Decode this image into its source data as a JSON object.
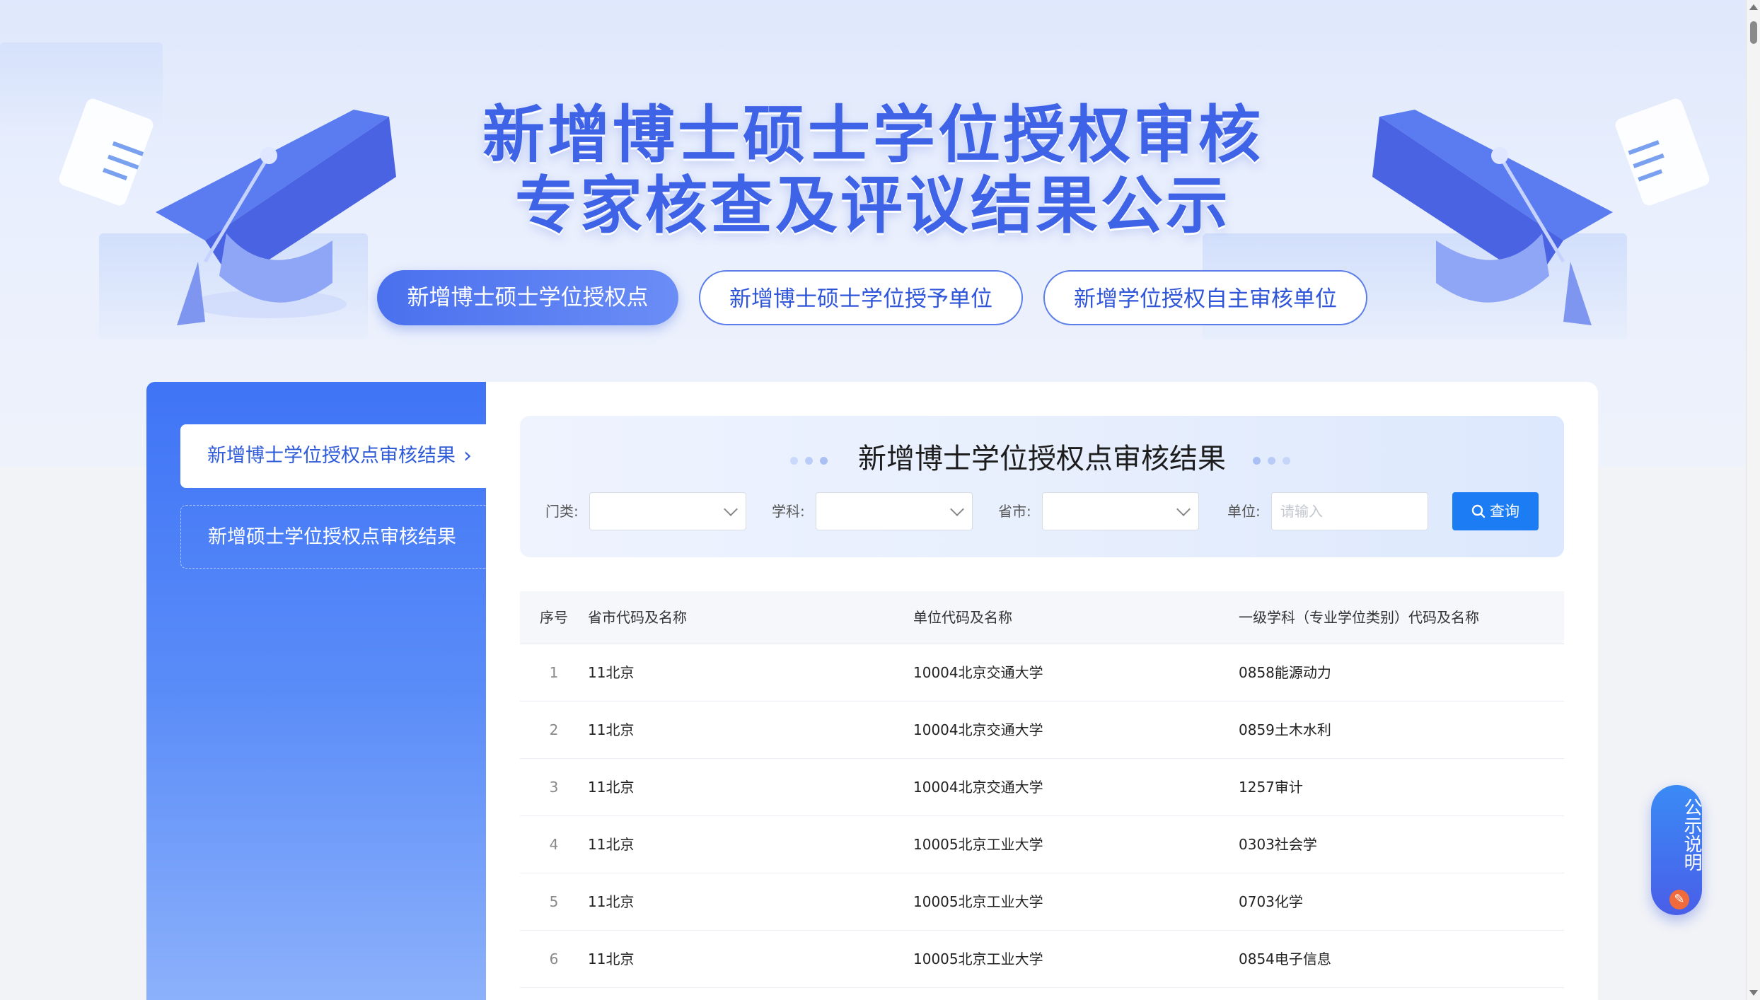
{
  "hero": {
    "title_line1": "新增博士硕士学位授权审核",
    "title_line2": "专家核查及评议结果公示",
    "accent": "#3f63e6"
  },
  "tabs": [
    {
      "label": "新增博士硕士学位授权点",
      "active": true
    },
    {
      "label": "新增博士硕士学位授予单位",
      "active": false
    },
    {
      "label": "新增学位授权自主审核单位",
      "active": false
    }
  ],
  "sidebar": {
    "items": [
      {
        "label": "新增博士学位授权点审核结果",
        "active": true
      },
      {
        "label": "新增硕士学位授权点审核结果",
        "active": false
      }
    ]
  },
  "filter": {
    "title": "新增博士学位授权点审核结果",
    "category_label": "门类:",
    "subject_label": "学科:",
    "province_label": "省市:",
    "unit_label": "单位:",
    "unit_placeholder": "请输入",
    "query_label": "查询"
  },
  "table": {
    "headers": [
      "序号",
      "省市代码及名称",
      "单位代码及名称",
      "一级学科（专业学位类别）代码及名称"
    ],
    "rows": [
      [
        "1",
        "11北京",
        "10004北京交通大学",
        "0858能源动力"
      ],
      [
        "2",
        "11北京",
        "10004北京交通大学",
        "0859土木水利"
      ],
      [
        "3",
        "11北京",
        "10004北京交通大学",
        "1257审计"
      ],
      [
        "4",
        "11北京",
        "10005北京工业大学",
        "0303社会学"
      ],
      [
        "5",
        "11北京",
        "10005北京工业大学",
        "0703化学"
      ],
      [
        "6",
        "11北京",
        "10005北京工业大学",
        "0854电子信息"
      ]
    ]
  },
  "notice": {
    "label": "公示说明",
    "badge_icon": "pencil-icon"
  }
}
